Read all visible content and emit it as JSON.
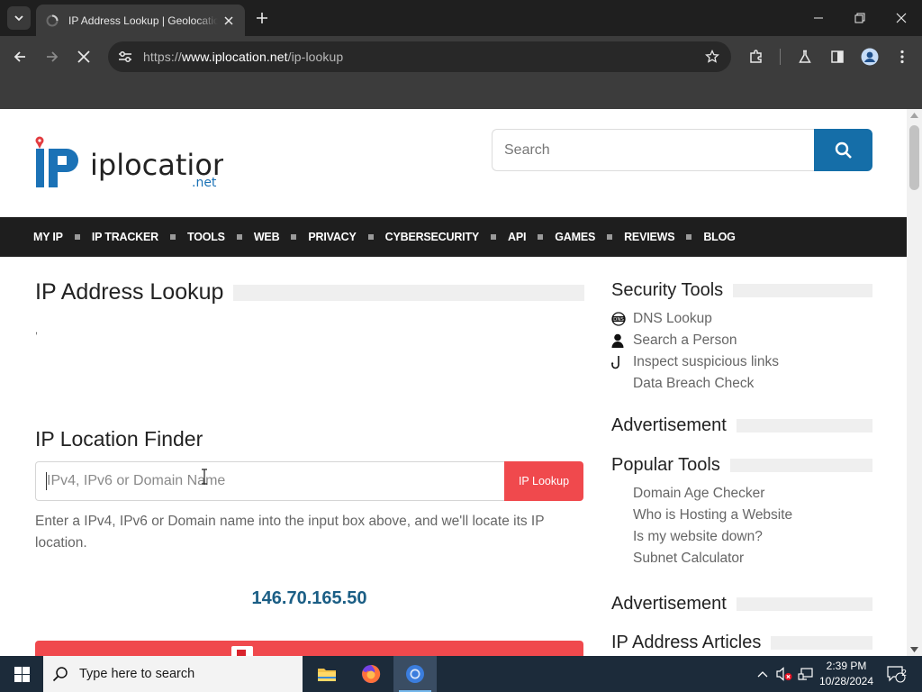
{
  "browser": {
    "tab_title": "IP Address Lookup | Geolocation",
    "url_prefix": "https://",
    "url_host": "www.iplocation.net",
    "url_path": "/ip-lookup"
  },
  "site": {
    "logo_text": "iplocation",
    "logo_suffix": ".net",
    "search_placeholder": "Search",
    "nav": [
      "MY IP",
      "IP TRACKER",
      "TOOLS",
      "WEB",
      "PRIVACY",
      "CYBERSECURITY",
      "API",
      "GAMES",
      "REVIEWS",
      "BLOG"
    ]
  },
  "main": {
    "title": "IP Address Lookup",
    "stray_mark": ",",
    "finder_title": "IP Location Finder",
    "finder_placeholder": "IPv4, IPv6 or Domain Name",
    "finder_button": "IP Lookup",
    "finder_help": "Enter a IPv4, IPv6 or Domain name into the input box above, and we'll locate its IP location.",
    "my_ip": "146.70.165.50"
  },
  "sidebar": {
    "security_title": "Security Tools",
    "security_items": [
      {
        "label": "DNS Lookup",
        "icon": "dns-icon"
      },
      {
        "label": "Search a Person",
        "icon": "person-icon"
      },
      {
        "label": "Inspect suspicious links",
        "icon": "hook-icon"
      },
      {
        "label": "Data Breach Check",
        "icon": ""
      }
    ],
    "ad_title_1": "Advertisement",
    "popular_title": "Popular Tools",
    "popular_items": [
      "Domain Age Checker",
      "Who is Hosting a Website",
      "Is my website down?",
      "Subnet Calculator"
    ],
    "ad_title_2": "Advertisement",
    "articles_title": "IP Address Articles"
  },
  "taskbar": {
    "search_placeholder": "Type here to search",
    "time": "2:39 PM",
    "date": "10/28/2024",
    "notification_count": "2"
  },
  "colors": {
    "brand_blue": "#156ea8",
    "accent_red": "#f0494d",
    "nav_bg": "#1e1e1e"
  }
}
